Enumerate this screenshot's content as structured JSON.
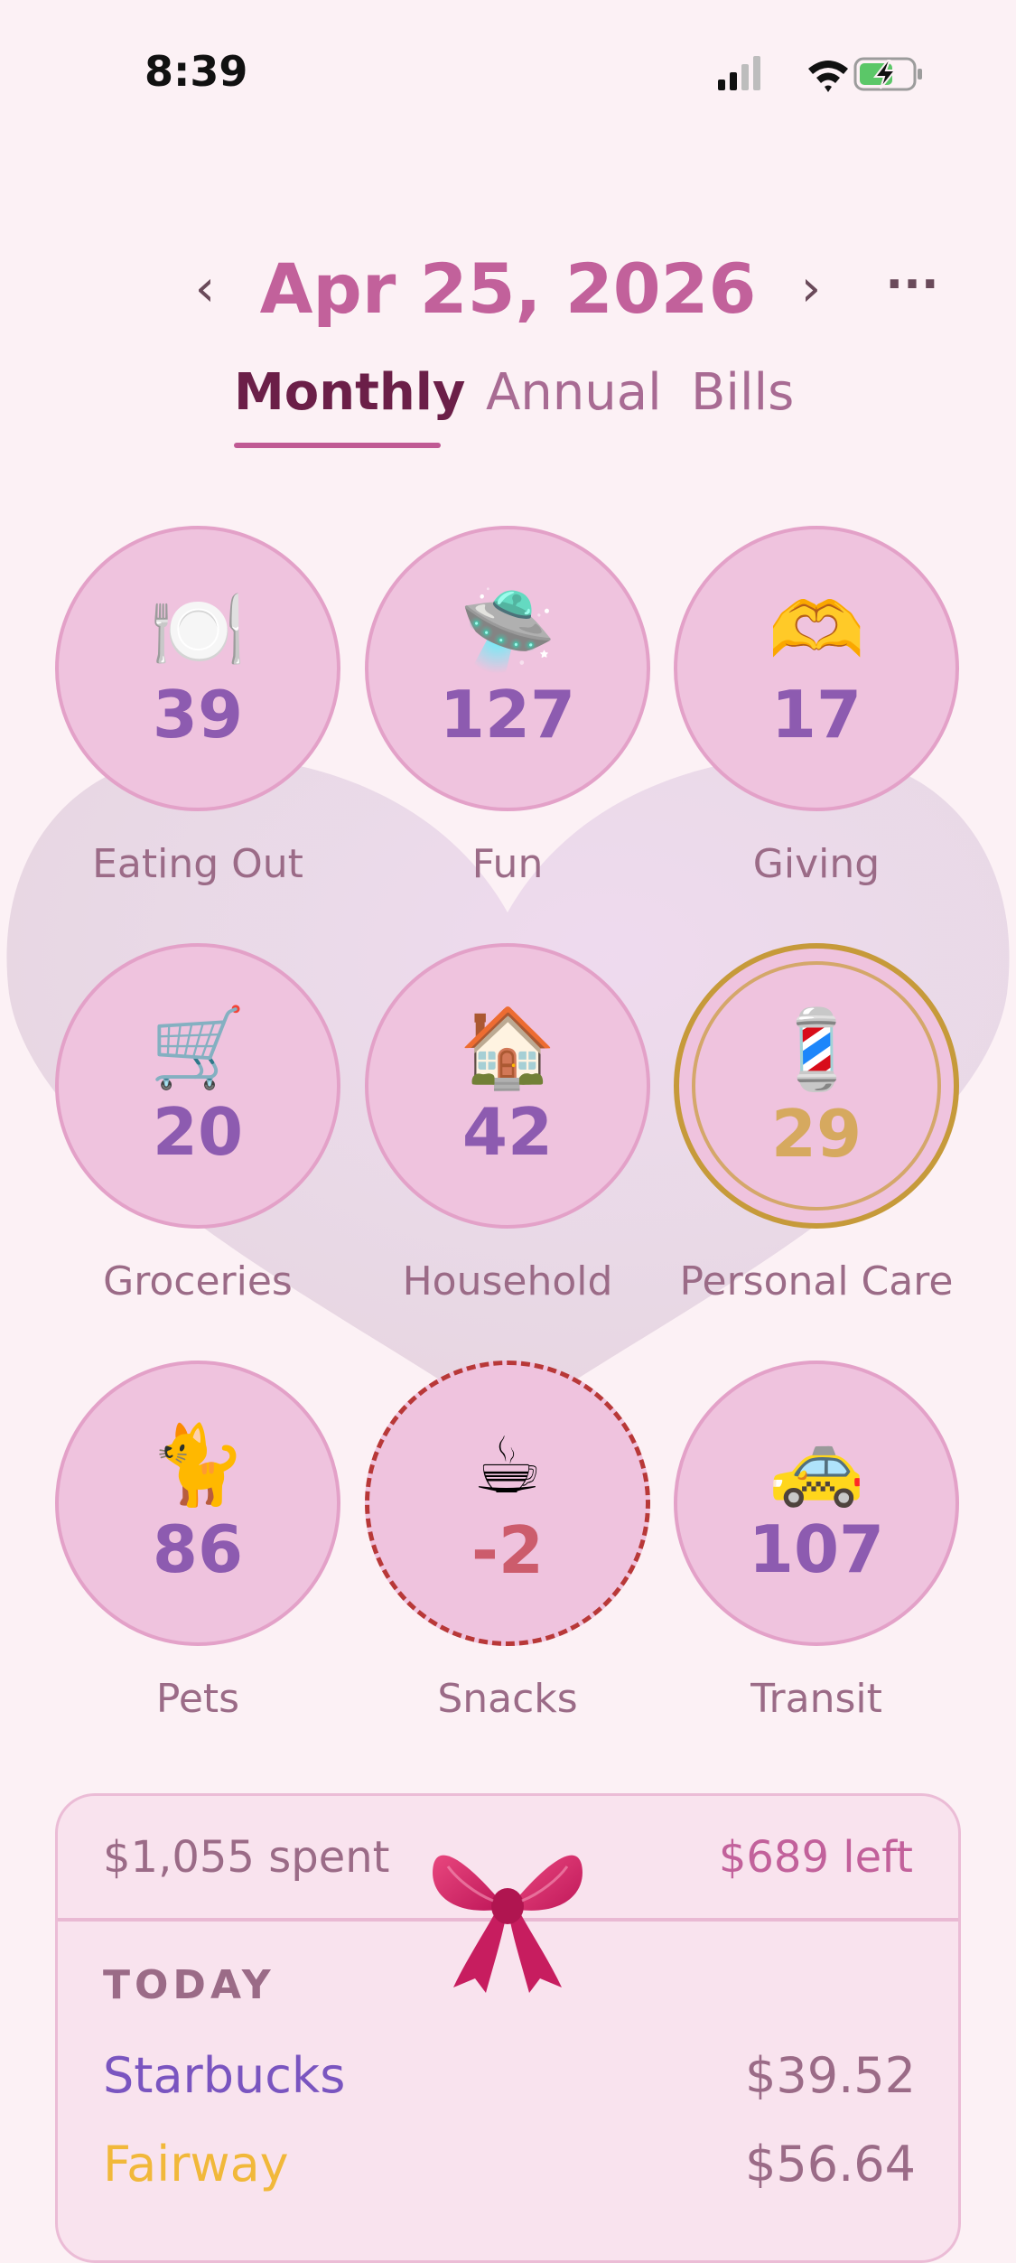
{
  "status": {
    "time": "8:39"
  },
  "header": {
    "date": "Apr 25, 2026",
    "prev_icon": "chevron-left-icon",
    "next_icon": "chevron-right-icon",
    "more_icon": "ellipsis-icon",
    "prev_glyph": "‹",
    "next_glyph": "›",
    "more_glyph": "···"
  },
  "tabs": [
    {
      "label": "Monthly",
      "active": true
    },
    {
      "label": "Annual",
      "active": false
    },
    {
      "label": "Bills",
      "active": false
    }
  ],
  "categories": [
    {
      "label": "Eating Out",
      "value": "39",
      "emoji": "🍽️",
      "icon": "plate-icon",
      "state": "normal"
    },
    {
      "label": "Fun",
      "value": "127",
      "emoji": "🛸",
      "icon": "ufo-icon",
      "state": "normal"
    },
    {
      "label": "Giving",
      "value": "17",
      "emoji": "🫶",
      "icon": "heart-hands-icon",
      "state": "normal"
    },
    {
      "label": "Groceries",
      "value": "20",
      "emoji": "🛒",
      "icon": "cart-icon",
      "state": "normal"
    },
    {
      "label": "Household",
      "value": "42",
      "emoji": "🏠",
      "icon": "house-icon",
      "state": "normal"
    },
    {
      "label": "Personal Care",
      "value": "29",
      "emoji": "💈",
      "icon": "barber-pole-icon",
      "state": "selected"
    },
    {
      "label": "Pets",
      "value": "86",
      "emoji": "🐈",
      "icon": "cat-icon",
      "state": "normal"
    },
    {
      "label": "Snacks",
      "value": "-2",
      "emoji": "☕",
      "icon": "coffee-icon",
      "state": "over"
    },
    {
      "label": "Transit",
      "value": "107",
      "emoji": "🚕",
      "icon": "taxi-icon",
      "state": "normal"
    }
  ],
  "summary": {
    "spent": "$1,055 spent",
    "left": "$689 left",
    "section": "TODAY",
    "transactions": [
      {
        "name": "Starbucks",
        "amount": "$39.52",
        "color": "#7a55c0"
      },
      {
        "name": "Fairway",
        "amount": "$56.64",
        "color": "#f1b83a"
      }
    ]
  },
  "colors": {
    "accent": "#c2619b",
    "bubble": "#efc3de",
    "value": "#8d5bb0",
    "selected_ring": "#c69a3a",
    "over_border": "#b83838",
    "background": "#fcf1f5"
  }
}
